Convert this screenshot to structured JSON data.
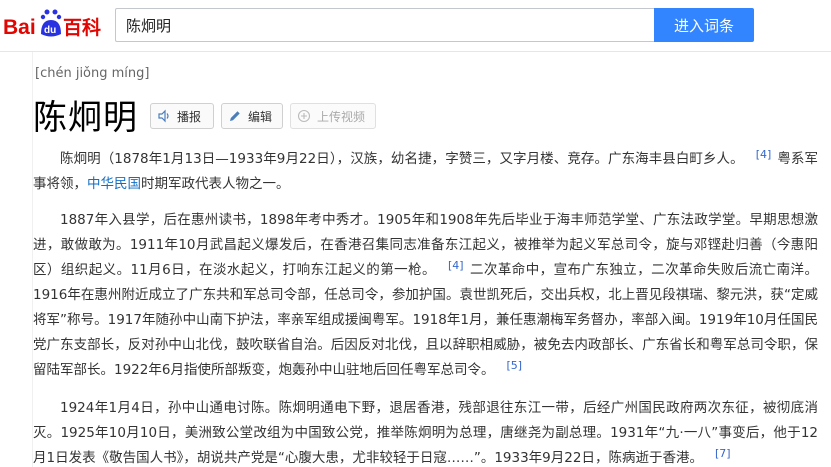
{
  "header": {
    "logo_text_1": "Bai",
    "logo_paw": "du",
    "logo_text_2": "百科",
    "search_value": "陈炯明",
    "search_button": "进入词条"
  },
  "entry": {
    "pinyin": "[chén jiǒng míng]",
    "title": "陈炯明",
    "tools": {
      "play": "播报",
      "edit": "编辑",
      "upload": "上传视频"
    }
  },
  "paragraphs": {
    "p1": {
      "a": "陈炯明（1878年1月13日—1933年9月22日），汉族，幼名捷，字赞三，又字月楼、竞存。广东海丰县白町乡人。",
      "ref1": "[4]",
      "b": "粤系军事将领，",
      "link": "中华民国",
      "c": "时期军政代表人物之一。"
    },
    "p2": {
      "a": "1887年入县学，后在惠州读书，1898年考中秀才。1905年和1908年先后毕业于海丰师范学堂、广东法政学堂。早期思想激进，敢做敢为。1911年10月武昌起义爆发后，在香港召集同志准备东江起义，被推举为起义军总司令，旋与邓铿赴归善（今惠阳区）组织起义。11月6日，在淡水起义，打响东江起义的第一枪。",
      "ref1": "[4]",
      "b": "二次革命中，宣布广东独立，二次革命失败后流亡南洋。1916年在惠州附近成立了广东共和军总司令部，任总司令，参加护国。袁世凯死后，交出兵权，北上晋见段祺瑞、黎元洪，获“定威将军”称号。1917年随孙中山南下护法，率亲军组成援闽粤军。1918年1月，兼任惠潮梅军务督办，率部入闽。1919年10月任国民党广东支部长，反对孙中山北伐，鼓吹联省自治。后因反对北伐，且以辞职相威胁，被免去内政部长、广东省长和粤军总司令职，保留陆军部长。1922年6月指使所部叛变，炮轰孙中山驻地后回任粤军总司令。",
      "ref2": "[5]"
    },
    "p3": {
      "a": "1924年1月4日，孙中山通电讨陈。陈炯明通电下野，退居香港，残部退往东江一带，后经广州国民政府两次东征，被彻底消灭。1925年10月10日，美洲致公堂改组为中国致公党，推举陈炯明为总理，唐继尧为副总理。1931年“九·一八”事变后，他于12月1日发表《敬告国人书》，胡说共产党是“心腹大患，尤非较轻于日寇……”。1933年9月22日，陈病逝于香港。",
      "ref1": "[7]"
    }
  },
  "colors": {
    "brand_red": "#e10601",
    "brand_blue": "#2932e1",
    "button_blue": "#3385ff",
    "link_blue": "#136ec2"
  }
}
